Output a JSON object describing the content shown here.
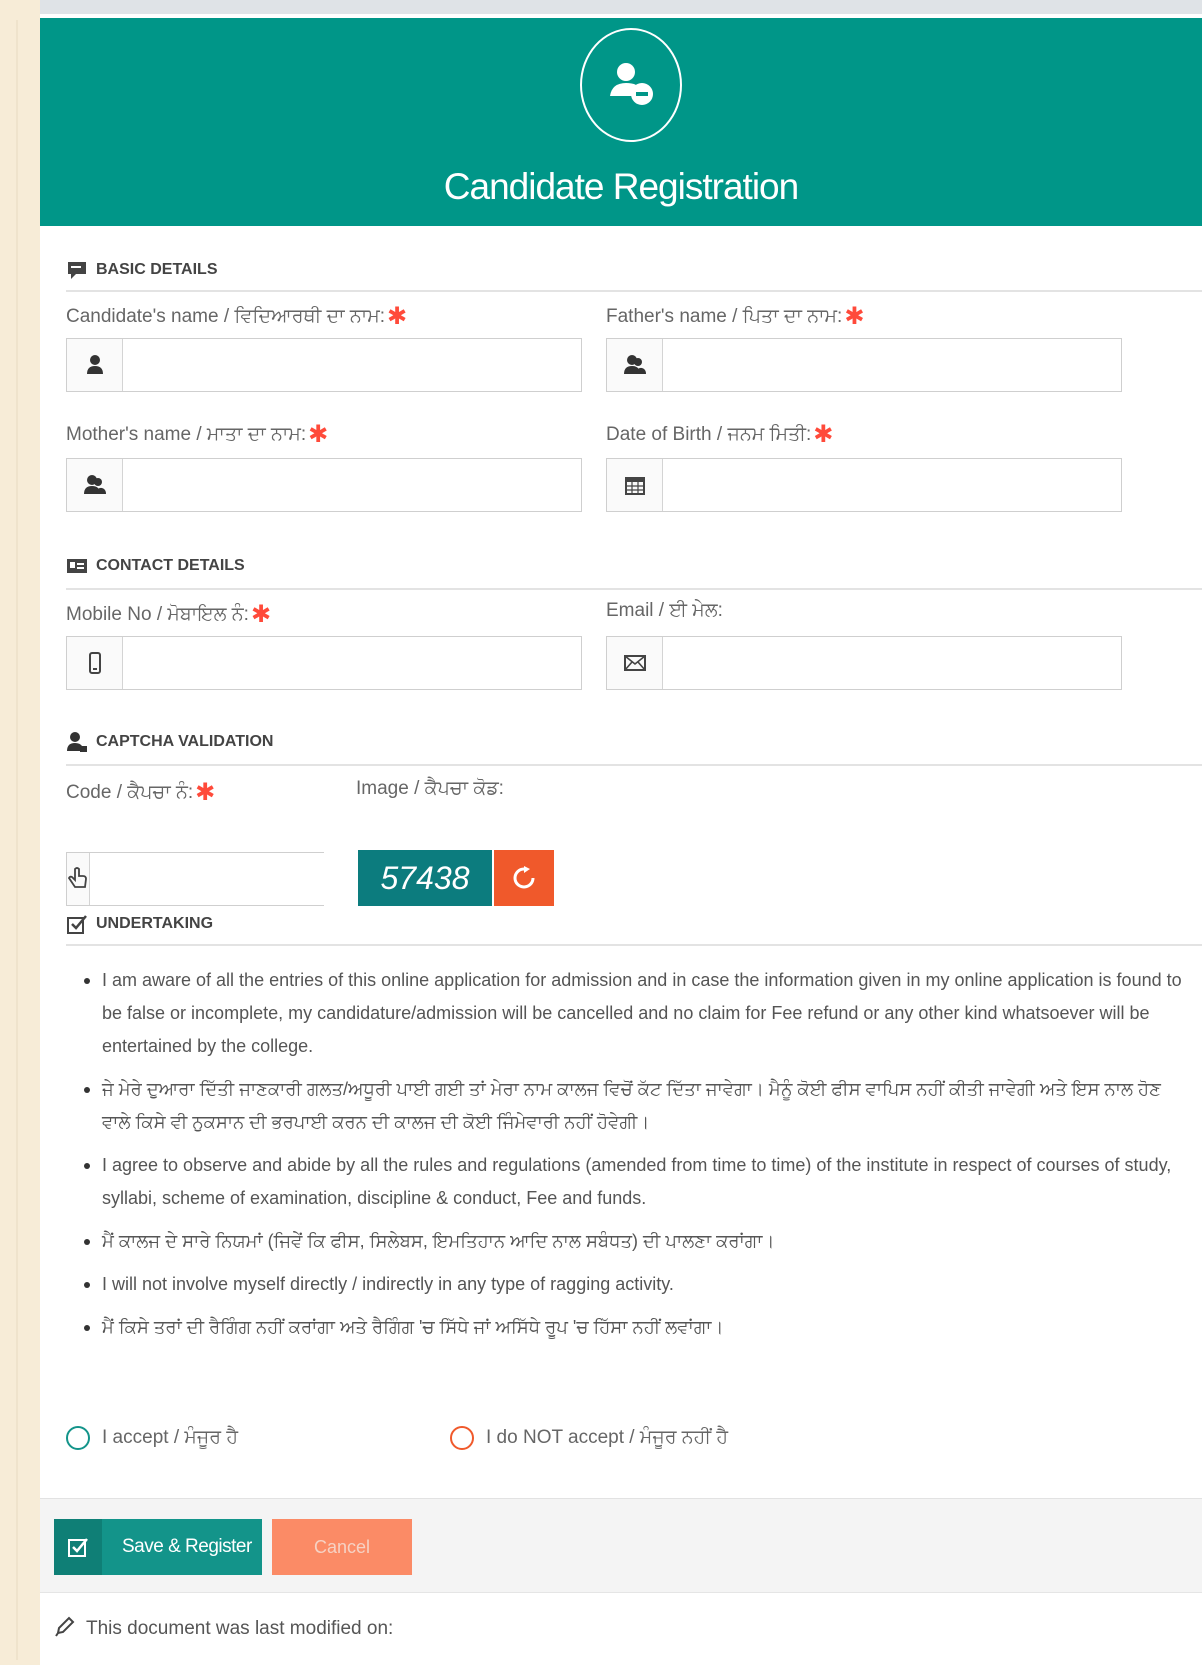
{
  "header": {
    "title": "Candidate Registration",
    "icon": "user-add-icon"
  },
  "sections": {
    "basic": "BASIC DETAILS",
    "contact": "CONTACT DETAILS",
    "captcha": "CAPTCHA VALIDATION",
    "undertaking": "UNDERTAKING"
  },
  "fields": {
    "candidate_name": {
      "label": "Candidate's name / ਵਿਦਿਆਰਥੀ ਦਾ ਨਾਮ:",
      "required": "✱",
      "value": ""
    },
    "father_name": {
      "label": "Father's name / ਪਿਤਾ ਦਾ ਨਾਮ:",
      "required": "✱",
      "value": ""
    },
    "mother_name": {
      "label": "Mother's name / ਮਾਤਾ ਦਾ ਨਾਮ:",
      "required": "✱",
      "value": ""
    },
    "dob": {
      "label": "Date of Birth / ਜਨਮ ਮਿਤੀ:",
      "required": "✱",
      "value": ""
    },
    "mobile": {
      "label": "Mobile No / ਮੋਬਾਇਲ ਨੰ:",
      "required": "✱",
      "value": ""
    },
    "email": {
      "label": "Email / ਈ ਮੇਲ:",
      "value": ""
    },
    "code": {
      "label": "Code / ਕੈਪਚਾ ਨੰ:",
      "required": "✱",
      "value": ""
    },
    "image": {
      "label": "Image / ਕੈਪਚਾ ਕੋਡ:"
    }
  },
  "captcha": {
    "code": "57438"
  },
  "undertaking_items": [
    "I am aware of all the entries of this online application for admission and in case the information given in my online application is found to be false or incomplete, my candidature/admission will be cancelled and no claim for Fee refund or any other kind whatsoever will be entertained by the college.",
    "ਜੇ ਮੇਰੇ ਦੁਆਰਾ ਦਿੱਤੀ ਜਾਣਕਾਰੀ ਗਲਤ/ਅਧੂਰੀ ਪਾਈ ਗਈ ਤਾਂ ਮੇਰਾ ਨਾਮ ਕਾਲਜ ਵਿਚੋਂ ਕੱਟ ਦਿੱਤਾ ਜਾਵੇਗਾ। ਮੈਨੂੰ ਕੋਈ ਫੀਸ ਵਾਪਿਸ ਨਹੀਂ ਕੀਤੀ ਜਾਵੇਗੀ ਅਤੇ ਇਸ ਨਾਲ ਹੋਣ ਵਾਲੇ ਕਿਸੇ ਵੀ ਨੁਕਸਾਨ ਦੀ ਭਰਪਾਈ ਕਰਨ ਦੀ ਕਾਲਜ ਦੀ ਕੋਈ ਜਿੰਮੇਵਾਰੀ ਨਹੀਂ ਹੋਵੇਗੀ।",
    "I agree to observe and abide by all the rules and regulations (amended from time to time) of the institute in respect of courses of study, syllabi, scheme of examination, discipline & conduct, Fee and funds.",
    "ਮੈਂ ਕਾਲਜ ਦੇ ਸਾਰੇ ਨਿਯਮਾਂ (ਜਿਵੇਂ ਕਿ ਫੀਸ, ਸਿਲੇਬਸ, ਇਮਤਿਹਾਨ ਆਦਿ ਨਾਲ ਸਬੰਧਤ) ਦੀ ਪਾਲਣਾ ਕਰਾਂਗਾ।",
    "I will not involve myself directly / indirectly in any type of ragging activity.",
    "ਮੈਂ ਕਿਸੇ ਤਰਾਂ ਦੀ ਰੈਗਿੰਗ ਨਹੀਂ ਕਰਾਂਗਾ ਅਤੇ ਰੈਗਿੰਗ 'ਚ ਸਿੱਧੇ ਜਾਂ ਅਸਿੱਧੇ ਰੂਪ 'ਚ ਹਿੱਸਾ ਨਹੀਂ ਲਵਾਂਗਾ।"
  ],
  "radios": {
    "accept": "I accept / ਮੰਜੂਰ ਹੈ",
    "not_accept": "I do NOT accept / ਮੰਜੂਰ ਨਹੀਂ ਹੈ"
  },
  "buttons": {
    "save": "Save & Register",
    "cancel": "Cancel"
  },
  "footer": {
    "modified": "This document was last modified on:"
  },
  "colors": {
    "header": "#009688",
    "required": "#ff4a3a",
    "captcha_bg": "#0c7c7e",
    "refresh": "#f0592b",
    "save": "#13948a",
    "cancel": "#fb8b66"
  }
}
